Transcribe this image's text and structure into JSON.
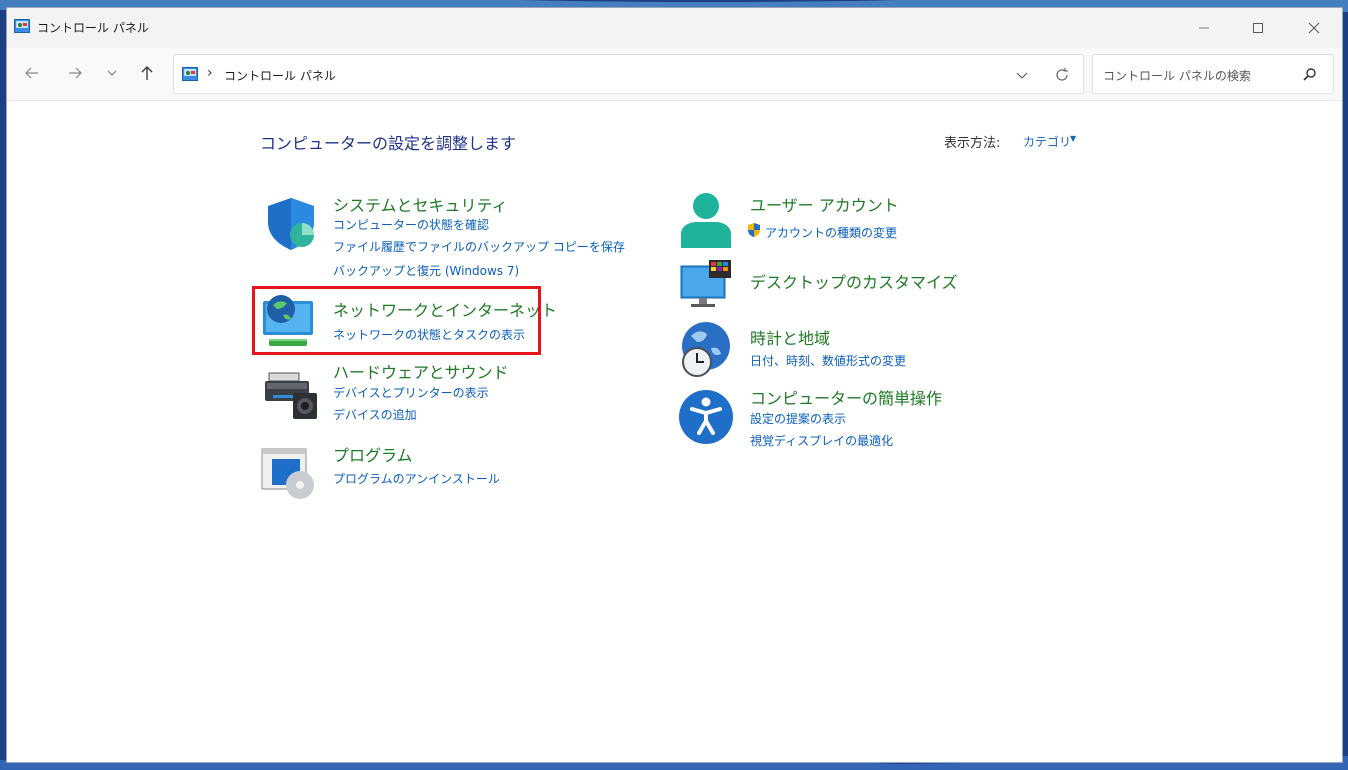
{
  "window": {
    "title": "コントロール パネル",
    "title_icon": "control-panel-icon"
  },
  "nav": {
    "back_icon": "arrow-left-icon",
    "forward_icon": "arrow-right-icon",
    "recent_icon": "chevron-down-icon",
    "up_icon": "arrow-up-icon"
  },
  "address": {
    "separator": "›",
    "path": "コントロール パネル"
  },
  "search": {
    "placeholder": "コントロール パネルの検索",
    "value": ""
  },
  "main": {
    "title": "コンピューターの設定を調整します",
    "view_by_label": "表示方法:",
    "view_by_value": "カテゴリ"
  },
  "categories": {
    "system": {
      "title": "システムとセキュリティ",
      "links": [
        "コンピューターの状態を確認",
        "ファイル履歴でファイルのバックアップ コピーを保存",
        "バックアップと復元 (Windows 7)"
      ]
    },
    "network": {
      "title": "ネットワークとインターネット",
      "links": [
        "ネットワークの状態とタスクの表示"
      ]
    },
    "hardware": {
      "title": "ハードウェアとサウンド",
      "links": [
        "デバイスとプリンターの表示",
        "デバイスの追加"
      ]
    },
    "programs": {
      "title": "プログラム",
      "links": [
        "プログラムのアンインストール"
      ]
    },
    "users": {
      "title": "ユーザー アカウント",
      "links": [
        "アカウントの種類の変更"
      ]
    },
    "appearance": {
      "title": "デスクトップのカスタマイズ",
      "links": []
    },
    "clock": {
      "title": "時計と地域",
      "links": [
        "日付、時刻、数値形式の変更"
      ]
    },
    "ease": {
      "title": "コンピューターの簡単操作",
      "links": [
        "設定の提案の表示",
        "視覚ディスプレイの最適化"
      ]
    }
  },
  "colors": {
    "category_title": "#1f7a26",
    "link": "#0a5fbd",
    "heading": "#1e3287",
    "highlight_box": "#e6151b"
  }
}
